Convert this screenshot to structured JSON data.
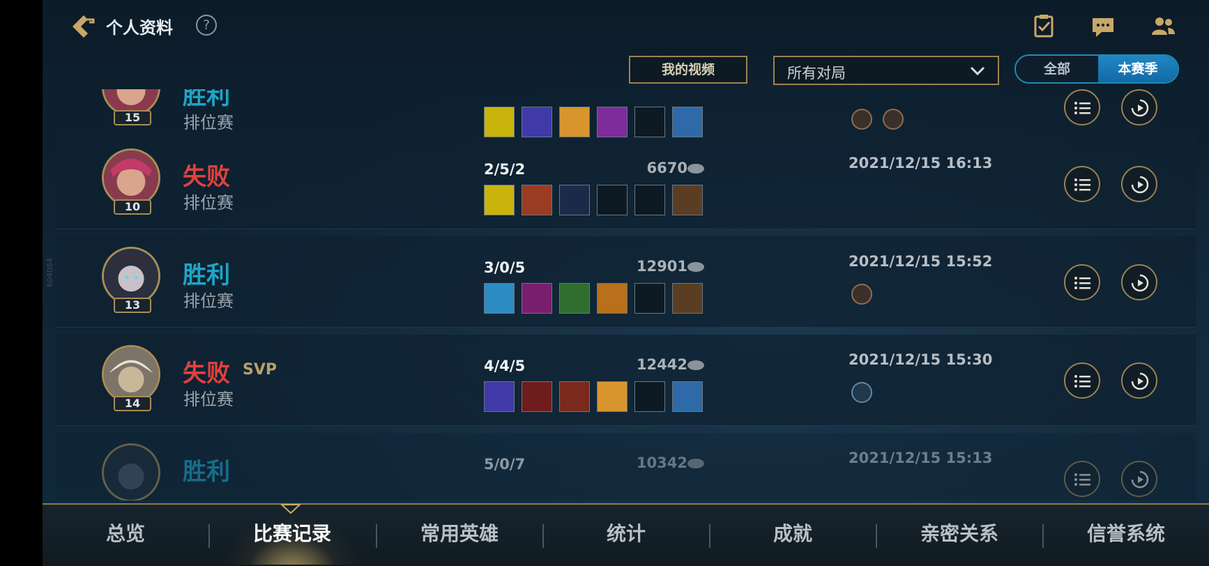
{
  "header": {
    "title": "个人资料",
    "help": "?",
    "my_videos": "我的视频",
    "filter_value": "所有对局",
    "season_all": "全部",
    "season_current": "本赛季"
  },
  "matches": [
    {
      "result": "胜利",
      "mode": "排位赛",
      "level": "15",
      "kda": "",
      "gold": "",
      "date": ""
    },
    {
      "result": "失败",
      "mode": "排位赛",
      "level": "10",
      "kda": "2/5/2",
      "gold": "6670",
      "date": "2021/12/15 16:13"
    },
    {
      "result": "胜利",
      "mode": "排位赛",
      "level": "13",
      "kda": "3/0/5",
      "gold": "12901",
      "date": "2021/12/15 15:52"
    },
    {
      "result": "失败",
      "svp": "SVP",
      "mode": "排位赛",
      "level": "14",
      "kda": "4/4/5",
      "gold": "12442",
      "date": "2021/12/15 15:30"
    },
    {
      "result": "胜利",
      "mode": "排位赛",
      "level": "",
      "kda": "5/0/7",
      "gold": "10342",
      "date": "2021/12/15 15:13"
    }
  ],
  "tabs": [
    "总览",
    "比赛记录",
    "常用英雄",
    "统计",
    "成就",
    "亲密关系",
    "信誉系统"
  ],
  "active_tab": "比赛记录",
  "icons": {
    "back": "back-arrow-icon",
    "help": "help-icon",
    "tasks": "clipboard-check-icon",
    "chat": "chat-icon",
    "friends": "friends-icon",
    "details": "list-icon",
    "replay": "replay-icon",
    "gold": "gold-coin-icon"
  },
  "colors": {
    "win": "#1fa5c8",
    "lose": "#e0413d",
    "accent_gold": "#9a8450",
    "toggle_blue": "#1e8bb6"
  }
}
